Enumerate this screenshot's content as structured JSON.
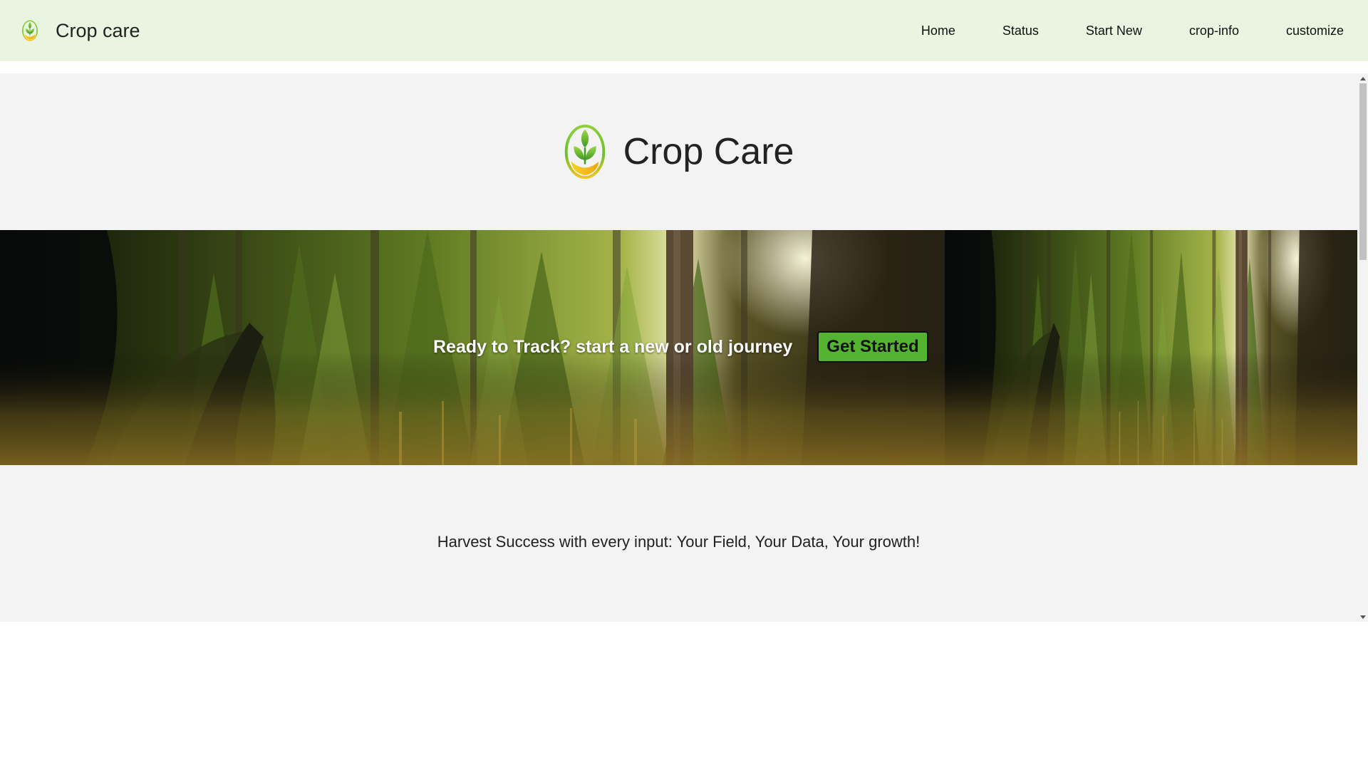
{
  "navbar": {
    "brand_name": "Crop care",
    "links": [
      "Home",
      "Status",
      "Start New",
      "crop-info",
      "customize"
    ]
  },
  "hero": {
    "title": "Crop Care"
  },
  "banner": {
    "text": "Ready to Track? start a new or old journey",
    "button_label": "Get Started"
  },
  "tagline": "Harvest Success with every input: Your Field, Your Data, Your growth!",
  "colors": {
    "navbar_bg": "#e9f5e0",
    "page_bg": "#f3f3f3",
    "button_bg": "#55b332",
    "logo_green": "#6cbf2e",
    "logo_yellow": "#f2c21b"
  },
  "icons": {
    "brand": "crop-logo-icon",
    "hero": "crop-logo-icon"
  }
}
